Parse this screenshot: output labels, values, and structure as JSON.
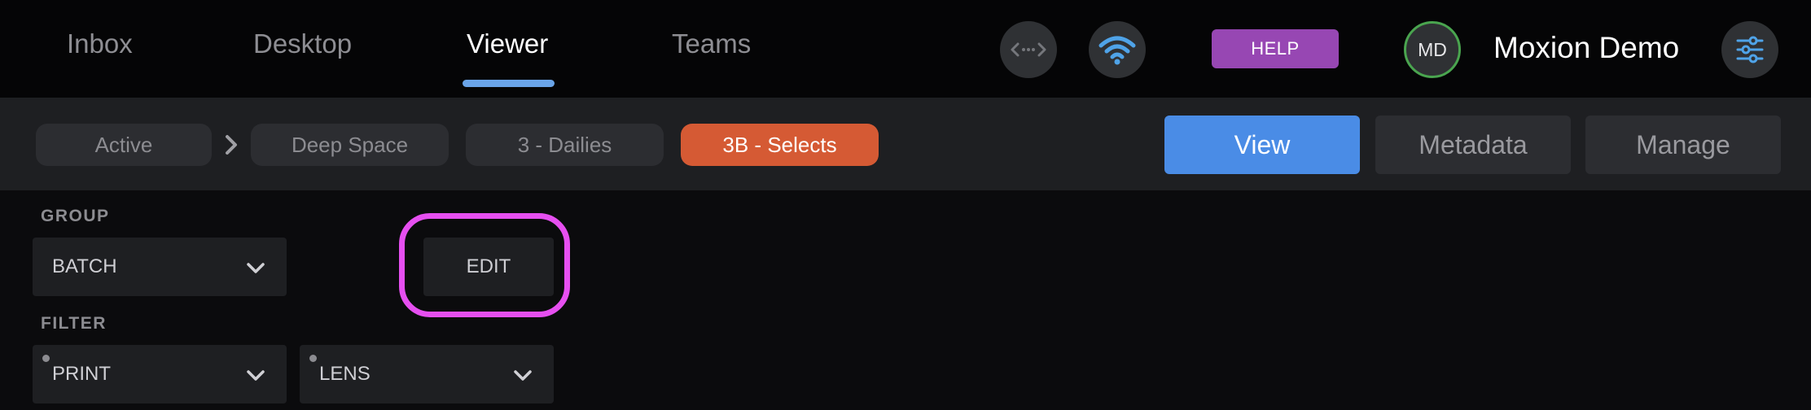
{
  "nav": {
    "tabs": [
      {
        "label": "Inbox"
      },
      {
        "label": "Desktop"
      },
      {
        "label": "Viewer"
      },
      {
        "label": "Teams"
      }
    ],
    "active_tab": "Viewer",
    "help_label": "HELP",
    "user_initials": "MD",
    "user_name": "Moxion Demo"
  },
  "breadcrumb": {
    "items": [
      {
        "label": "Active"
      },
      {
        "label": "Deep Space"
      },
      {
        "label": "3 - Dailies"
      },
      {
        "label": "3B - Selects"
      }
    ],
    "active_item": "3B - Selects"
  },
  "modes": {
    "items": [
      {
        "label": "View"
      },
      {
        "label": "Metadata"
      },
      {
        "label": "Manage"
      }
    ],
    "active_mode": "View"
  },
  "group": {
    "label": "GROUP",
    "value": "BATCH",
    "edit_label": "EDIT"
  },
  "filter": {
    "label": "FILTER",
    "selects": [
      {
        "value": "PRINT"
      },
      {
        "value": "LENS"
      }
    ]
  },
  "icons": {
    "link": "code-link-icon",
    "wifi": "wifi-icon",
    "settings": "sliders-icon",
    "chevron": "chevron-down-icon",
    "separator": "chevron-right-icon"
  },
  "colors": {
    "accent_blue": "#4a8ce6",
    "underline_blue": "#6aa4e8",
    "help_purple": "#9747b3",
    "active_crumb_orange": "#d55a34",
    "avatar_ring_green": "#4aa54f",
    "highlight_magenta": "#e64ff0",
    "background": "#0b0b0d"
  }
}
